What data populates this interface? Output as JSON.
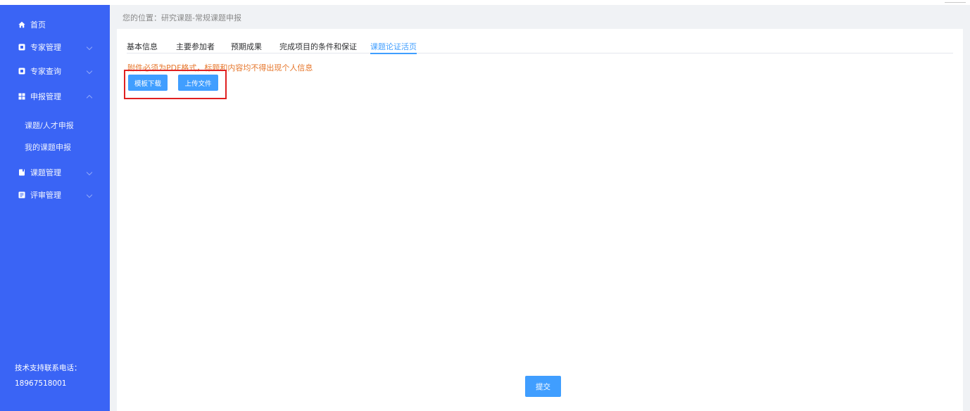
{
  "sidebar": {
    "items": [
      {
        "label": "首页",
        "icon": "home-icon",
        "expandable": false
      },
      {
        "label": "专家管理",
        "icon": "expert-icon",
        "expandable": true,
        "expanded": false
      },
      {
        "label": "专家查询",
        "icon": "query-icon",
        "expandable": true,
        "expanded": false
      },
      {
        "label": "申报管理",
        "icon": "grid-icon",
        "expandable": true,
        "expanded": true
      },
      {
        "label": "课题管理",
        "icon": "book-icon",
        "expandable": true,
        "expanded": false
      },
      {
        "label": "评审管理",
        "icon": "review-icon",
        "expandable": true,
        "expanded": false
      }
    ],
    "sub_items": [
      {
        "label": "课题/人才申报"
      },
      {
        "label": "我的课题申报"
      }
    ],
    "support_label": "技术支持联系电话：",
    "support_phone": "18967518001"
  },
  "breadcrumb": "您的位置：研究课题-常规课题申报",
  "tabs": [
    {
      "label": "基本信息",
      "active": false
    },
    {
      "label": "主要参加者",
      "active": false
    },
    {
      "label": "预期成果",
      "active": false
    },
    {
      "label": "完成项目的条件和保证",
      "active": false
    },
    {
      "label": "课题论证活页",
      "active": true
    }
  ],
  "warning": "附件必须为PDF格式，标题和内容均不得出现个人信息",
  "buttons": {
    "download_label": "模板下载",
    "upload_label": "上传文件",
    "submit_label": "提交"
  },
  "colors": {
    "sidebar": "#3a64f5",
    "primary": "#409eff",
    "warning": "#e6762b",
    "highlight": "#e02020"
  }
}
